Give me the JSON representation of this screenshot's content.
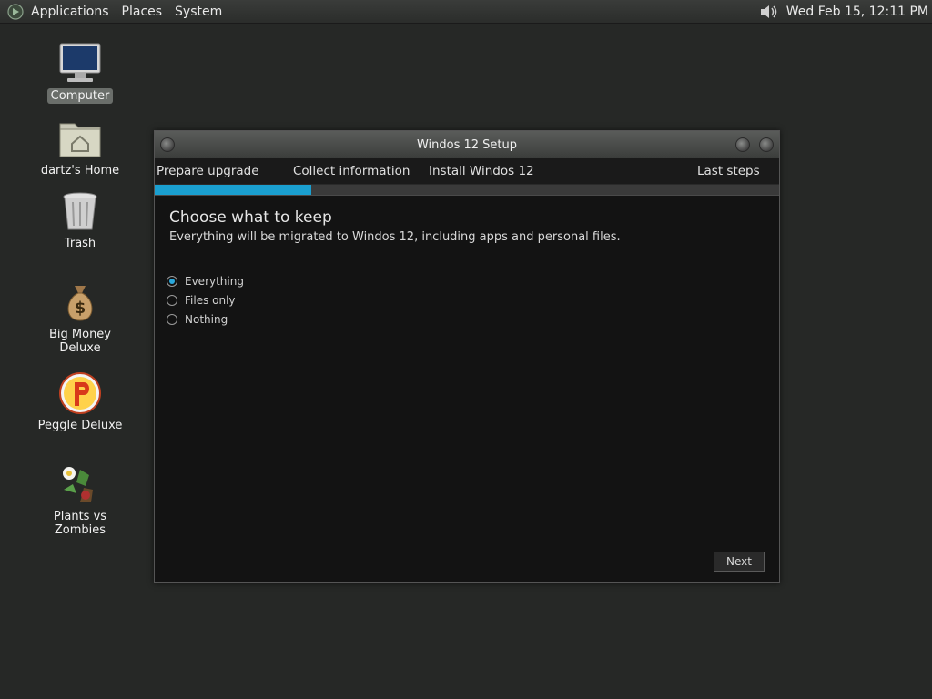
{
  "panel": {
    "menus": [
      "Applications",
      "Places",
      "System"
    ],
    "clock": "Wed Feb 15, 12:11 PM",
    "icons": {
      "logo": "distro-logo-icon",
      "volume": "volume-icon"
    }
  },
  "desktop": {
    "icons": [
      {
        "label": "Computer",
        "icon": "computer-icon"
      },
      {
        "label": "dartz's Home",
        "icon": "home-folder-icon"
      },
      {
        "label": "Trash",
        "icon": "trash-icon"
      },
      {
        "label": "Big Money Deluxe",
        "icon": "money-bag-icon"
      },
      {
        "label": "Peggle Deluxe",
        "icon": "peggle-icon"
      },
      {
        "label": "Plants vs Zombies",
        "icon": "plants-vs-zombies-icon"
      }
    ]
  },
  "window": {
    "title": "Windos 12 Setup",
    "steps": [
      "Prepare upgrade",
      "Collect information",
      "Install Windos 12",
      "Last steps"
    ],
    "progress": 0.25,
    "accent": "#1a9fd0",
    "heading": "Choose what to keep",
    "subtext": "Everything will be migrated to Windos 12, including apps and personal files.",
    "options": [
      {
        "label": "Everything",
        "selected": true
      },
      {
        "label": "Files only",
        "selected": false
      },
      {
        "label": "Nothing",
        "selected": false
      }
    ],
    "next_label": "Next"
  }
}
